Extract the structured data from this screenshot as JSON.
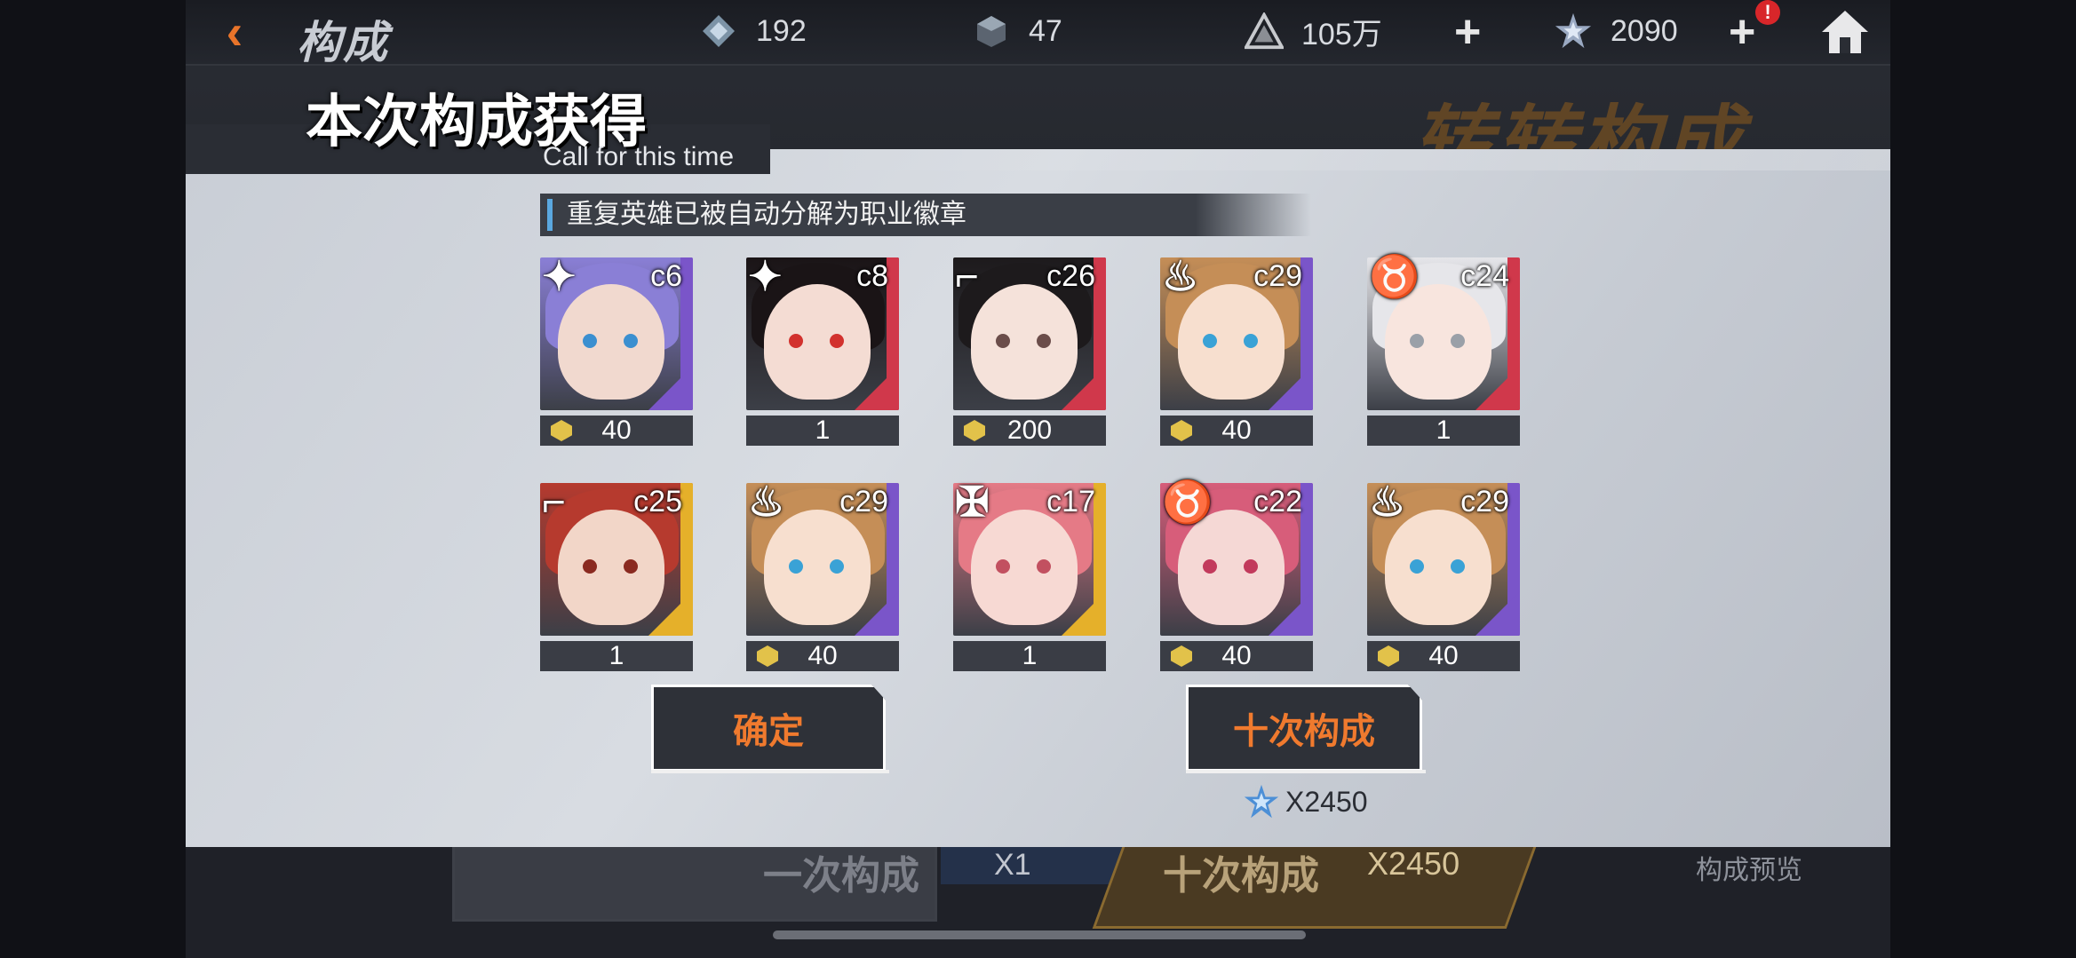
{
  "topbar": {
    "back_icon": "back-arrow-icon",
    "title": "构成",
    "resources": [
      {
        "icon": "crystal-icon",
        "value": "192"
      },
      {
        "icon": "cube-ticket-icon",
        "value": "47"
      },
      {
        "icon": "gold-pyramid-icon",
        "value": "105万"
      },
      {
        "icon": "star-gem-icon",
        "value": "2090"
      }
    ],
    "alert_label": "!",
    "home_icon": "home-icon"
  },
  "background": {
    "banner_text": "转转构成",
    "single_label": "一次构成",
    "single_cost": "X1",
    "ten_label": "十次构成",
    "ten_cost": "X2450",
    "preview_label": "构成预览"
  },
  "dialog": {
    "title": "本次构成获得",
    "subtitle": "Call for this time",
    "notice": "重复英雄已被自动分解为职业徽章",
    "cards": [
      {
        "code": "c6",
        "count": "40",
        "badge": true,
        "class_icon": "shuriken-class-icon",
        "rank_color": "#7a55c9",
        "hair": "#8a7fd6",
        "skin": "#f1d9cf",
        "eye": "#3b8fd0"
      },
      {
        "code": "c8",
        "count": "1",
        "badge": false,
        "class_icon": "shuriken-class-icon",
        "rank_color": "#d0384b",
        "hair": "#1a1416",
        "skin": "#f4dcd3",
        "eye": "#d2312d"
      },
      {
        "code": "c26",
        "count": "200",
        "badge": true,
        "class_icon": "gun-class-icon",
        "rank_color": "#d0384b",
        "hair": "#1d1a1c",
        "skin": "#f5e2da",
        "eye": "#6b4d4a"
      },
      {
        "code": "c29",
        "count": "40",
        "badge": true,
        "class_icon": "flame-class-icon",
        "rank_color": "#7a55c9",
        "hair": "#c58e57",
        "skin": "#f7dfcf",
        "eye": "#3aa2d6"
      },
      {
        "code": "c24",
        "count": "1",
        "badge": false,
        "class_icon": "horned-class-icon",
        "rank_color": "#d0384b",
        "hair": "#e6e6ea",
        "skin": "#f8e5de",
        "eye": "#9aa0a8"
      },
      {
        "code": "c25",
        "count": "1",
        "badge": false,
        "class_icon": "gun-class-icon",
        "rank_color": "#e5b02a",
        "hair": "#b63a2e",
        "skin": "#f2d6c8",
        "eye": "#8a2a20"
      },
      {
        "code": "c29",
        "count": "40",
        "badge": true,
        "class_icon": "flame-class-icon",
        "rank_color": "#7a55c9",
        "hair": "#c58e57",
        "skin": "#f7dfcf",
        "eye": "#3aa2d6"
      },
      {
        "code": "c17",
        "count": "1",
        "badge": false,
        "class_icon": "cross-class-icon",
        "rank_color": "#e5b02a",
        "hair": "#e57a86",
        "skin": "#f7d9d3",
        "eye": "#c25060"
      },
      {
        "code": "c22",
        "count": "40",
        "badge": true,
        "class_icon": "horned-class-icon",
        "rank_color": "#7a55c9",
        "hair": "#d75d7a",
        "skin": "#f5d8d5",
        "eye": "#c23a5c"
      },
      {
        "code": "c29",
        "count": "40",
        "badge": true,
        "class_icon": "flame-class-icon",
        "rank_color": "#7a55c9",
        "hair": "#c58e57",
        "skin": "#f7dfcf",
        "eye": "#3aa2d6"
      }
    ],
    "confirm_label": "确定",
    "ten_pull_label": "十次构成",
    "ten_pull_cost": "X2450",
    "cost_icon": "star-gem-icon"
  }
}
